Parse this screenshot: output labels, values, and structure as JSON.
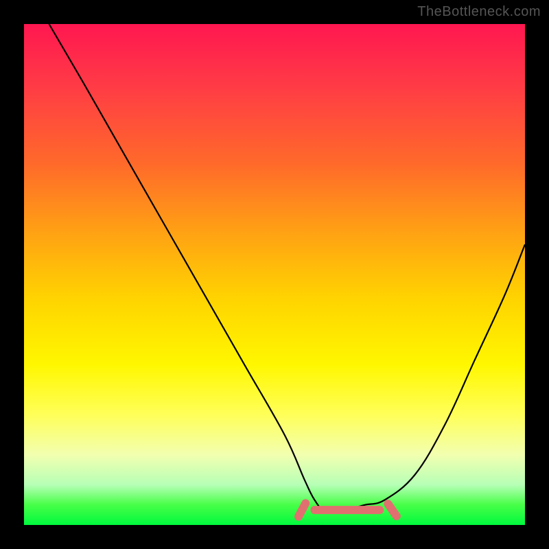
{
  "watermark": "TheBottleneck.com",
  "gradient_colors": {
    "top": "#ff1750",
    "mid_upper": "#ffa313",
    "mid": "#fff700",
    "mid_lower": "#f2ffb0",
    "bottom": "#00f93e"
  },
  "chart_data": {
    "type": "line",
    "title": "",
    "xlabel": "",
    "ylabel": "",
    "xlim": [
      0,
      100
    ],
    "ylim": [
      0,
      100
    ],
    "background": "rainbow-gradient-red-to-green-vertical",
    "series": [
      {
        "name": "bottleneck-curve",
        "color": "#000000",
        "x": [
          5,
          12,
          20,
          28,
          36,
          44,
          52,
          56,
          58,
          60,
          64,
          68,
          72,
          78,
          84,
          90,
          96,
          100
        ],
        "y": [
          100,
          88,
          74,
          60,
          46,
          32,
          18,
          9,
          5,
          3,
          3,
          4,
          5,
          10,
          20,
          33,
          46,
          56
        ]
      }
    ],
    "highlight": {
      "name": "optimal-range-marker",
      "color": "#e07070",
      "segments": [
        {
          "x_start": 54,
          "x_end": 57,
          "angle_deg": -62
        },
        {
          "x_start": 58,
          "x_end": 71,
          "angle_deg": 0
        },
        {
          "x_start": 72,
          "x_end": 75,
          "angle_deg": 55
        }
      ],
      "y_approx": 3
    }
  }
}
